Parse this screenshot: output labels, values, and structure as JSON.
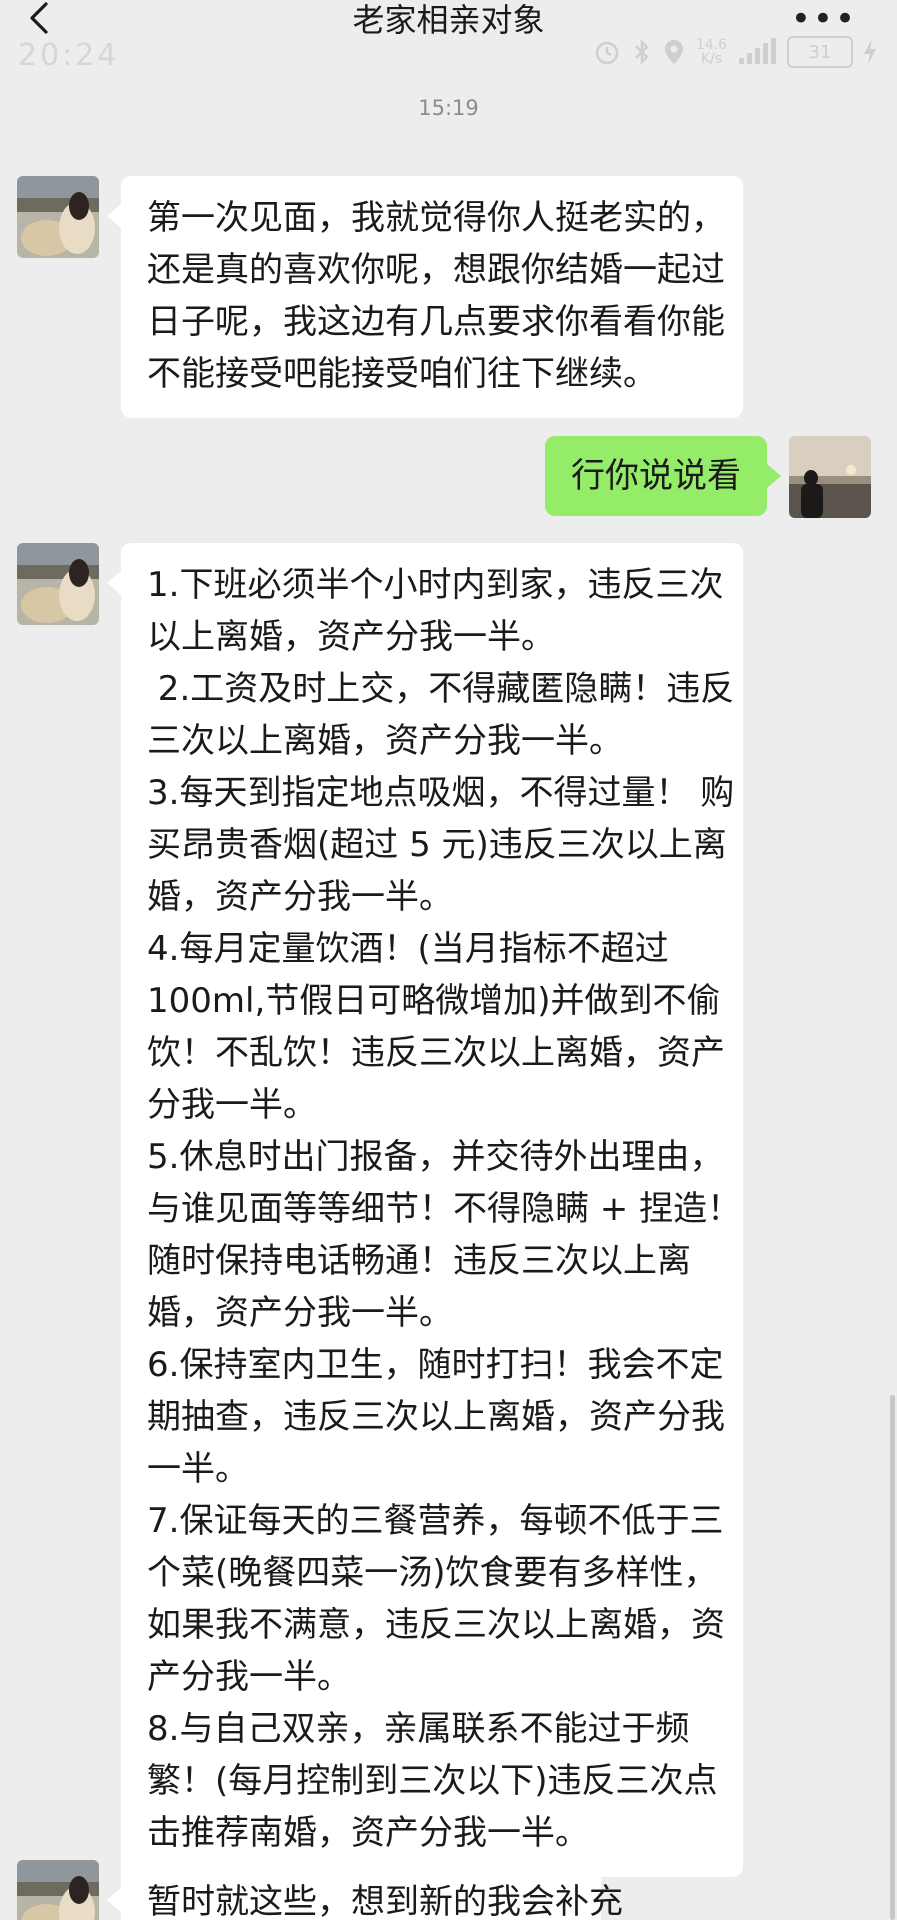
{
  "header": {
    "title": "老家相亲对象",
    "back_icon": "chevron-left-icon",
    "more_label": "•••"
  },
  "status_bar": {
    "time": "20:24",
    "network_speed_value": "14.6",
    "network_speed_unit": "K/s",
    "battery": "31"
  },
  "chat": {
    "timestamp": "15:19",
    "messages": [
      {
        "sender": "contact",
        "lines": [
          "第一次见面，我就觉得你人挺老实的，",
          "还是真的喜欢你呢，想跟你结婚一起过",
          "日子呢，我这边有几点要求你看看你能",
          "不能接受吧能接受咱们往下继续。"
        ]
      },
      {
        "sender": "me",
        "text": "行你说说看"
      },
      {
        "sender": "contact",
        "lines": [
          "1.下班必须半个小时内到家，违反三次",
          "以上离婚，资产分我一半。",
          " 2.工资及时上交，不得藏匿隐瞒！违反",
          "三次以上离婚，资产分我一半。",
          "3.每天到指定地点吸烟，不得过量！ 购",
          "买昂贵香烟(超过 5 元)违反三次以上离",
          "婚，资产分我一半。",
          "4.每月定量饮酒！(当月指标不超过",
          "100ml,节假日可略微增加)并做到不偷",
          "饮！不乱饮！违反三次以上离婚，资产",
          "分我一半。",
          "5.休息时出门报备，并交待外出理由，",
          "与谁见面等等细节！不得隐瞒 + 捏造！",
          "随时保持电话畅通！违反三次以上离",
          "婚，资产分我一半。",
          "6.保持室内卫生，随时打扫！我会不定",
          "期抽查，违反三次以上离婚，资产分我",
          "一半。",
          "7.保证每天的三餐营养，每顿不低于三",
          "个菜(晚餐四菜一汤)饮食要有多样性，",
          "如果我不满意，违反三次以上离婚，资",
          "产分我一半。",
          "8.与自己双亲，亲属联系不能过于频",
          "繁！(每月控制到三次以下)违反三次点",
          "击推荐南婚，资产分我一半。"
        ]
      },
      {
        "sender": "contact",
        "lines": [
          "暂时就这些，想到新的我会补充"
        ]
      }
    ]
  }
}
